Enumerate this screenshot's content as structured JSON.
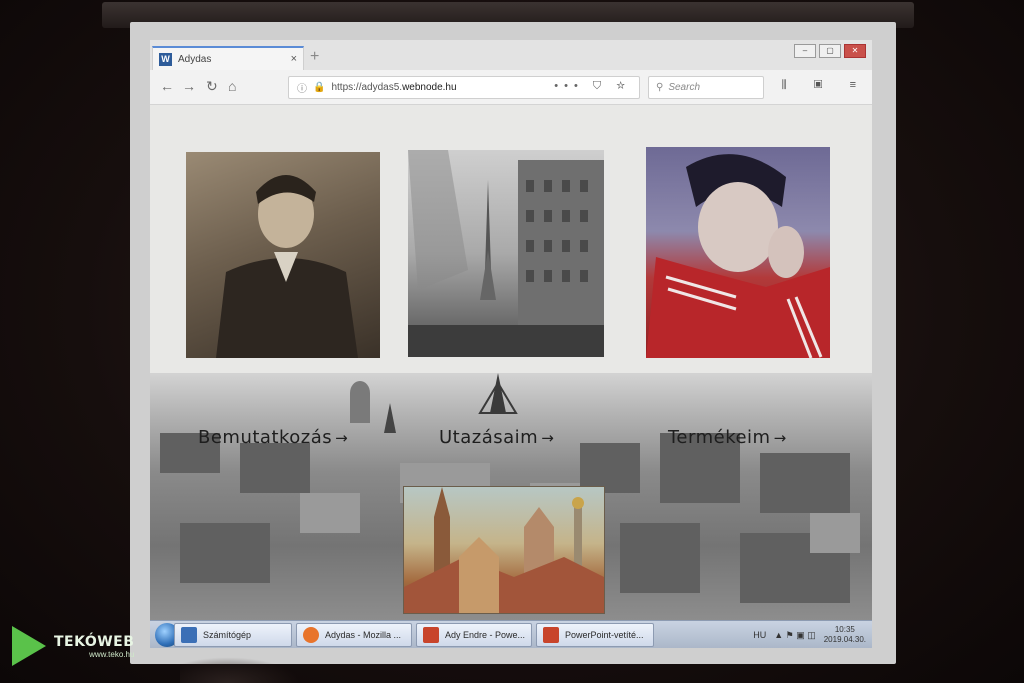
{
  "browser": {
    "tab": {
      "favicon": "W",
      "title": "Adydas",
      "close": "×"
    },
    "new_tab": "+",
    "url_prefix": "https://adydas5.",
    "url_domain": "webnode.hu",
    "url_actions": "••• ⛉ ☆",
    "search_placeholder": "Search",
    "window_controls": [
      "–",
      "▢",
      "✕"
    ]
  },
  "page": {
    "links": [
      {
        "label": "Bemutatkozás",
        "arrow": "→"
      },
      {
        "label": "Utazásaim",
        "arrow": "→"
      },
      {
        "label": "Termékeim",
        "arrow": "→"
      }
    ]
  },
  "taskbar": {
    "items": [
      {
        "label": "Számítógép",
        "icon": "computer-icon",
        "color": "#3b6fb6"
      },
      {
        "label": "Adydas - Mozilla ...",
        "icon": "firefox-icon",
        "color": "#e8742b"
      },
      {
        "label": "Ady Endre - Powe...",
        "icon": "powerpoint-icon",
        "color": "#c8442b"
      },
      {
        "label": "PowerPoint-vetíté...",
        "icon": "powerpoint-icon",
        "color": "#c8442b"
      }
    ],
    "tray": {
      "language": "HU",
      "time": "10:35",
      "date": "2019.04.30."
    }
  },
  "watermark": {
    "brand": "TEKÓWEB",
    "site": "www.teko.hu"
  }
}
